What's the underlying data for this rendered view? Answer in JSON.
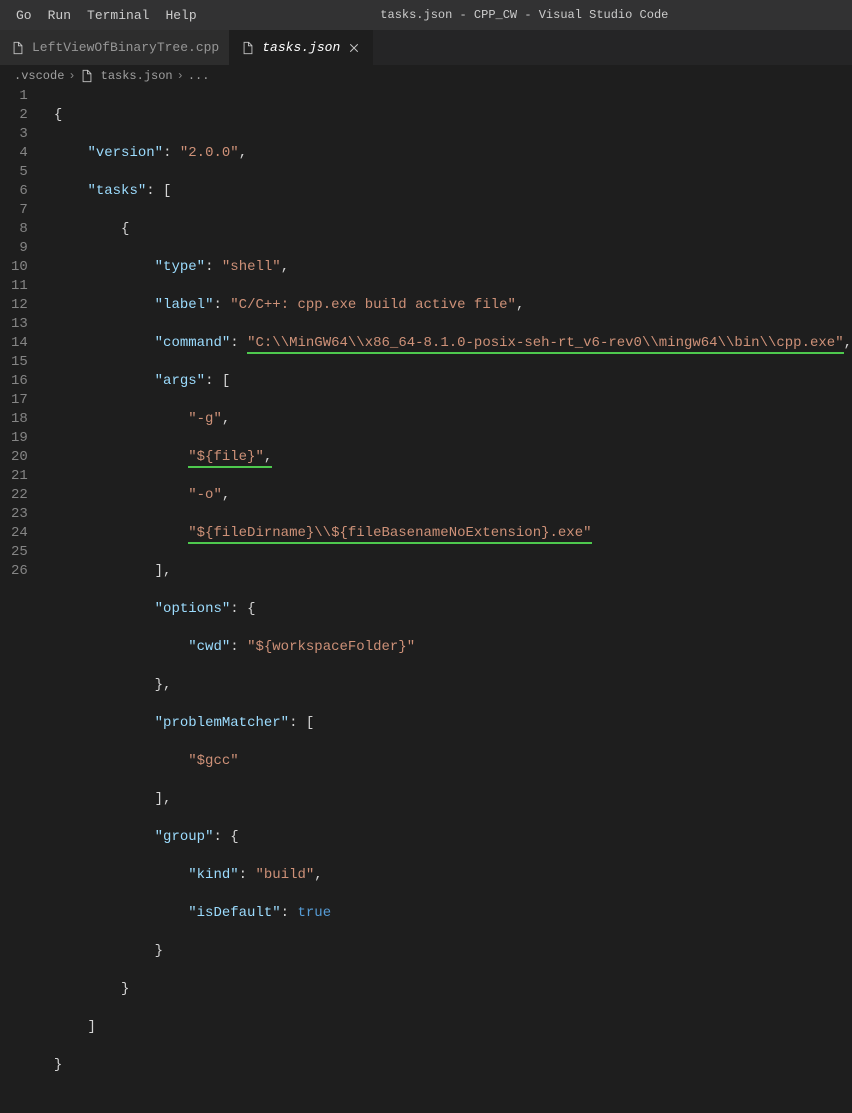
{
  "window_title": "tasks.json - CPP_CW - Visual Studio Code",
  "menu": {
    "go": "Go",
    "run": "Run",
    "terminal": "Terminal",
    "help": "Help"
  },
  "tabs": [
    {
      "label": "LeftViewOfBinaryTree.cpp",
      "active": false
    },
    {
      "label": "tasks.json",
      "active": true
    }
  ],
  "breadcrumbs": {
    "folder": ".vscode",
    "file": "tasks.json",
    "more": "..."
  },
  "code": {
    "l1": "{",
    "l2_k": "\"version\"",
    "l2_v": "\"2.0.0\"",
    "l3_k": "\"tasks\"",
    "l4": "{",
    "l5_k": "\"type\"",
    "l5_v": "\"shell\"",
    "l6_k": "\"label\"",
    "l6_v": "\"C/C++: cpp.exe build active file\"",
    "l7_k": "\"command\"",
    "l7_v": "\"C:\\\\MinGW64\\\\x86_64-8.1.0-posix-seh-rt_v6-rev0\\\\mingw64\\\\bin\\\\cpp.exe\"",
    "l8_k": "\"args\"",
    "l9_v": "\"-g\"",
    "l10_v": "\"${file}\"",
    "l11_v": "\"-o\"",
    "l12_v": "\"${fileDirname}\\\\${fileBasenameNoExtension}.exe\"",
    "l13": "],",
    "l14_k": "\"options\"",
    "l15_k": "\"cwd\"",
    "l15_v": "\"${workspaceFolder}\"",
    "l16": "},",
    "l17_k": "\"problemMatcher\"",
    "l18_v": "\"$gcc\"",
    "l19": "],",
    "l20_k": "\"group\"",
    "l21_k": "\"kind\"",
    "l21_v": "\"build\"",
    "l22_k": "\"isDefault\"",
    "l22_v": "true",
    "l23": "}",
    "l24": "}",
    "l25": "]",
    "l26": "}"
  },
  "line_numbers": [
    "1",
    "2",
    "3",
    "4",
    "5",
    "6",
    "7",
    "8",
    "9",
    "10",
    "11",
    "12",
    "13",
    "14",
    "15",
    "16",
    "17",
    "18",
    "19",
    "20",
    "21",
    "22",
    "23",
    "24",
    "25",
    "26"
  ]
}
